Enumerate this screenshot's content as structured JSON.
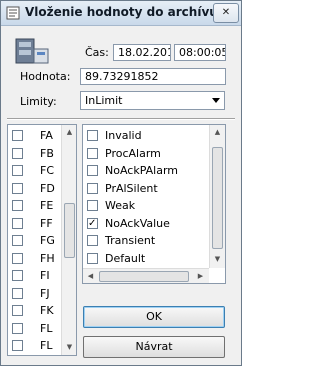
{
  "window": {
    "title": "Vloženie hodnoty do archívu",
    "close_glyph": "✕"
  },
  "form": {
    "time_label": "Čas:",
    "date_value": "18.02.2010",
    "time_value": "08:00:05",
    "value_label": "Hodnota:",
    "value_value": "89.73291852",
    "limits_label": "Limity:",
    "limits_selected": "InLimit"
  },
  "left_list": {
    "items": [
      {
        "label": "FA",
        "checked": false
      },
      {
        "label": "FB",
        "checked": false
      },
      {
        "label": "FC",
        "checked": false
      },
      {
        "label": "FD",
        "checked": false
      },
      {
        "label": "FE",
        "checked": false
      },
      {
        "label": "FF",
        "checked": false
      },
      {
        "label": "FG",
        "checked": false
      },
      {
        "label": "FH",
        "checked": false
      },
      {
        "label": "FI",
        "checked": false
      },
      {
        "label": "FJ",
        "checked": false
      },
      {
        "label": "FK",
        "checked": false
      },
      {
        "label": "FL",
        "checked": false
      },
      {
        "label": "FL",
        "checked": false
      }
    ]
  },
  "flags_list": {
    "items": [
      {
        "label": "Invalid",
        "checked": false
      },
      {
        "label": "ProcAlarm",
        "checked": false
      },
      {
        "label": "NoAckPAlarm",
        "checked": false
      },
      {
        "label": "PrAlSilent",
        "checked": false
      },
      {
        "label": "Weak",
        "checked": false
      },
      {
        "label": "NoAckValue",
        "checked": true
      },
      {
        "label": "Transient",
        "checked": false
      },
      {
        "label": "Default",
        "checked": false
      }
    ]
  },
  "buttons": {
    "ok_label": "OK",
    "back_label": "Návrat"
  }
}
